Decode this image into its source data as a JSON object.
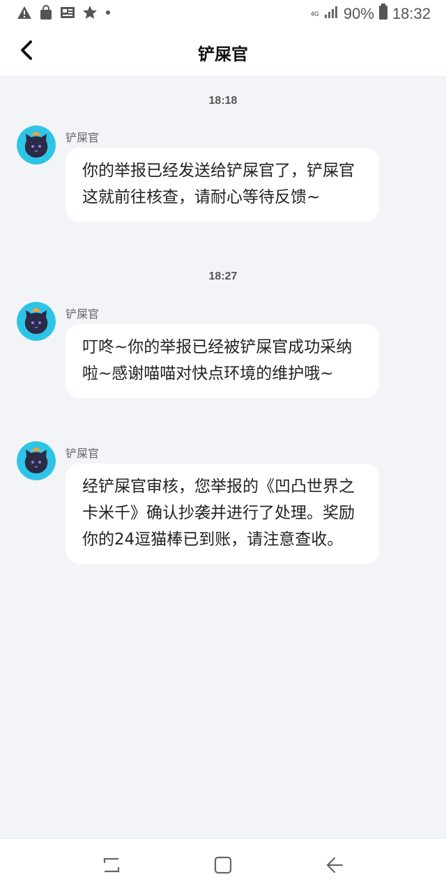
{
  "status_bar": {
    "network_type": "4G",
    "battery_percent": "90%",
    "time": "18:32",
    "notification_icons": [
      "warning-icon",
      "shopping-bag-icon",
      "news-icon",
      "star-icon",
      "dot-icon"
    ]
  },
  "header": {
    "title": "铲屎官"
  },
  "chat": {
    "groups": [
      {
        "time": "18:18",
        "sender": "铲屎官",
        "text": "你的举报已经发送给铲屎官了，铲屎官这就前往核查，请耐心等待反馈~"
      },
      {
        "time": "18:27",
        "sender": "铲屎官",
        "text": "叮咚~你的举报已经被铲屎官成功采纳啦~感谢喵喵对快点环境的维护哦~"
      },
      {
        "sender": "铲屎官",
        "text": "经铲屎官审核，您举报的《凹凸世界之卡米千》确认抄袭并进行了处理。奖励你的24逗猫棒已到账，请注意查收。"
      }
    ]
  },
  "colors": {
    "background": "#f3f4f8",
    "bubble": "#ffffff",
    "avatar_bg": "#2ec4e8",
    "avatar_cat": "#2b2b45"
  }
}
